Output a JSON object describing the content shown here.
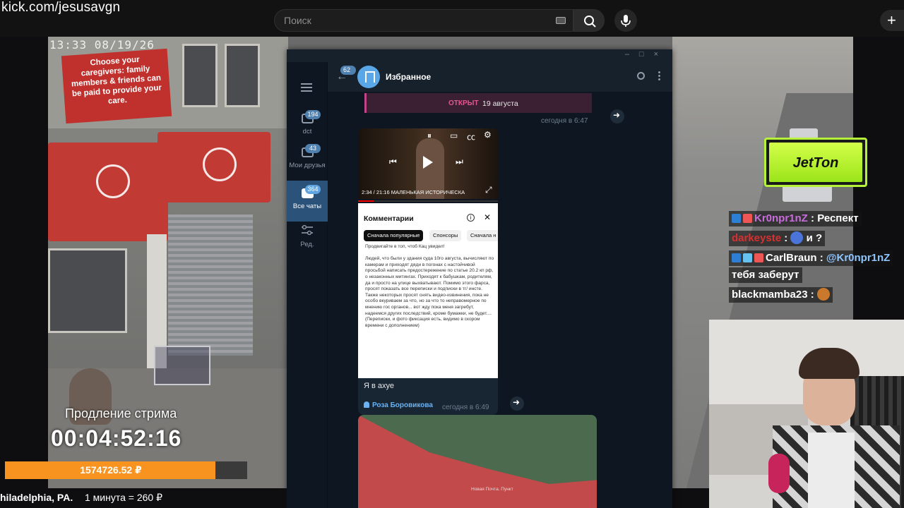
{
  "browser": {
    "url": "kick.com/jesusavgn",
    "search_placeholder": "Поиск",
    "plus": "+"
  },
  "scene": {
    "clock": "13:33  08/19/26",
    "sign_text": "Choose your caregivers: family members & friends can be paid to provide your care."
  },
  "telegram": {
    "chat_title": "Избранное",
    "back_badge": "62",
    "rail": [
      {
        "label": "dct",
        "badge": "194",
        "active": false
      },
      {
        "label": "Мои друзья",
        "badge": "43",
        "active": false
      },
      {
        "label": "Все чаты",
        "badge": "364",
        "active": true
      },
      {
        "label": "Ред.",
        "badge": "",
        "active": false
      }
    ],
    "open_card": {
      "label": "ОТКРЫТ",
      "date": "19 августа"
    },
    "ts_1": "сегодня в 6:47",
    "video": {
      "time": "2:34 / 21:16",
      "title": "МАЛЕНЬКАЯ ИСТОРИЧЕСКА"
    },
    "comments": {
      "title": "Комментарии",
      "chips": [
        "Сначала популярные",
        "Спонсоры",
        "Сначала н"
      ],
      "text": "Продвигайте в топ, чтоб Кац увидел!\n\nЛюдей, что были у здания суда 10го августа, вычисляют по камерам и приходят дяди в погонах с настойчивой просьбой написать предостережение по статье 20.2 кп рф, о незаконных митингах. Приходят к бабушкам, родителям, да и просто на улице выхватывают. Помимо этого фарса, просят показать все переписки и подписки в тг/ инсте. Также некоторых просят снять видео-извинения, пока не особо вкуриваем за что, но за что то неправомерное по мнению гос органов... вот жду пока меня загребут, надеемся других последствий, кроме бумажки, не будет....\n(Переписки, и фото фиксация есть, видимо в скором времени с дополнением)"
    },
    "caption": "Я в ахуе",
    "sender": "Роза  Боровикова",
    "ts_2": "сегодня в 6:49",
    "map_label": "Новая Почта. Пункт"
  },
  "overlay": {
    "jetton": "JetTon",
    "chat": [
      {
        "user": "Kr0npr1nZ",
        "sep": " : ",
        "msg": "Респект",
        "color": "pink"
      },
      {
        "user": "darkeyste",
        "sep": " : ",
        "msg": " и ?",
        "color": "red"
      },
      {
        "user": "CarlBraun",
        "sep": " : ",
        "msg": "@Kr0npr1nZ",
        "color": "white"
      },
      {
        "user": "",
        "sep": "",
        "msg": "тебя заберут",
        "color": "white"
      },
      {
        "user": "blackmamba23",
        "sep": " : ",
        "msg": "",
        "color": "white"
      }
    ]
  },
  "widgets": {
    "extension_title": "Продление стрима",
    "extension_timer": "00:04:52:16",
    "donate_amount": "1574726.52 ₽",
    "donate_progress": 0.87,
    "location": "hiladelphia, PA.",
    "rate": "1 минута = 260 ₽"
  },
  "colors": {
    "kick_bg": "#0e0e10",
    "telegram_bg": "#0e1621",
    "telegram_active": "#2b5278",
    "donate_orange": "#f7931e",
    "jetton_green": "#b6f23a"
  }
}
